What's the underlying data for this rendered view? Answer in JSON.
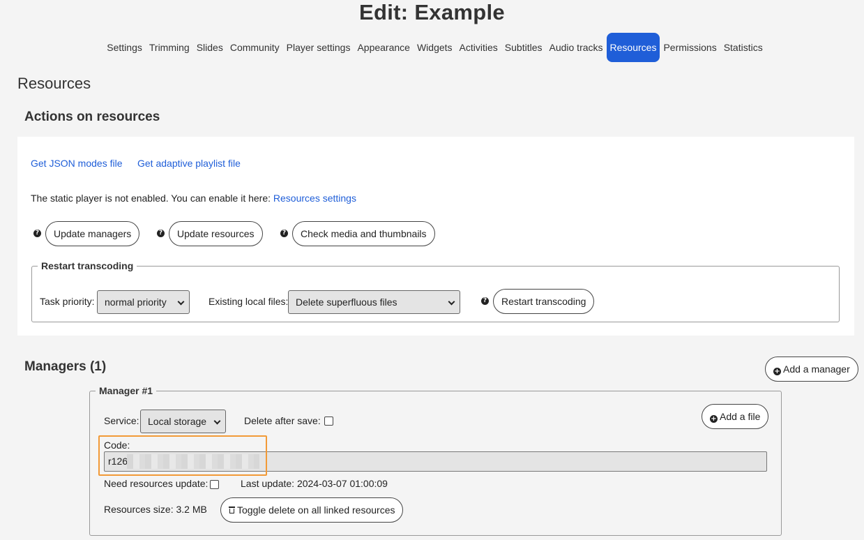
{
  "page": {
    "title": "Edit: Example"
  },
  "tabs": [
    {
      "label": "Settings"
    },
    {
      "label": "Trimming"
    },
    {
      "label": "Slides"
    },
    {
      "label": "Community"
    },
    {
      "label": "Player settings"
    },
    {
      "label": "Appearance"
    },
    {
      "label": "Widgets"
    },
    {
      "label": "Activities"
    },
    {
      "label": "Subtitles"
    },
    {
      "label": "Audio tracks"
    },
    {
      "label": "Resources"
    },
    {
      "label": "Permissions"
    },
    {
      "label": "Statistics"
    }
  ],
  "active_tab": "Resources",
  "section": {
    "heading": "Resources"
  },
  "actions": {
    "heading": "Actions on resources",
    "json_link": "Get JSON modes file",
    "playlist_link": "Get adaptive playlist file",
    "static_notice": "The static player is not enabled. You can enable it here:",
    "static_link": "Resources settings",
    "help_glyph": "?",
    "update_managers": "Update managers",
    "update_resources": "Update resources",
    "check_media": "Check media and thumbnails"
  },
  "restart": {
    "legend": "Restart transcoding",
    "priority_label": "Task priority:",
    "priority_value": "normal priority",
    "files_label": "Existing local files:",
    "files_value": "Delete superfluous files",
    "button": "Restart transcoding"
  },
  "managers": {
    "heading": "Managers (1)",
    "add_manager": "Add a manager",
    "plus_glyph": "+",
    "manager": {
      "legend": "Manager #1",
      "service_label": "Service:",
      "service_value": "Local storage",
      "delete_after_save_label": "Delete after save:",
      "add_file": "Add a file",
      "code_label": "Code:",
      "code_value": "r126",
      "need_update_label": "Need resources update:",
      "last_update": "Last update: 2024-03-07 01:00:09",
      "resources_size": "Resources size: 3.2 MB",
      "toggle_delete": "Toggle delete on all linked resources"
    }
  },
  "colors": {
    "accent": "#1f5ed8",
    "highlight": "#f29a37",
    "background": "#f4f4f4"
  }
}
